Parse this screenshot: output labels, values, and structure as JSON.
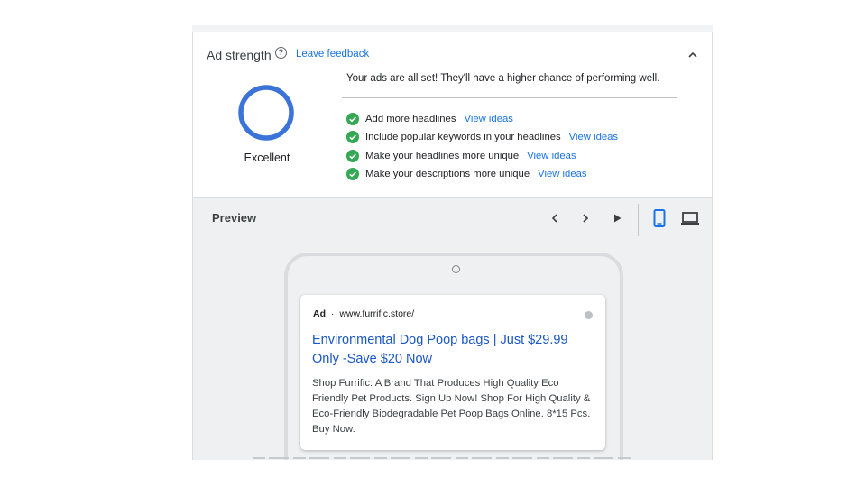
{
  "ad_strength": {
    "title": "Ad strength",
    "help_icon": "help-circle-icon",
    "feedback_link": "Leave feedback",
    "collapse_icon": "chevron-up-icon",
    "rating": "Excellent",
    "rating_color": "#3b73d9",
    "status_message": "Your ads are all set! They'll have a higher chance of performing well.",
    "check_color": "#34a853",
    "suggestions": [
      {
        "text": "Add more headlines",
        "link": "View ideas"
      },
      {
        "text": "Include popular keywords in your headlines",
        "link": "View ideas"
      },
      {
        "text": "Make your headlines more unique",
        "link": "View ideas"
      },
      {
        "text": "Make your descriptions more unique",
        "link": "View ideas"
      }
    ]
  },
  "preview": {
    "title": "Preview",
    "controls": [
      "chevron-left-icon",
      "chevron-right-icon",
      "play-icon",
      "mobile-device-icon",
      "laptop-icon"
    ],
    "ad": {
      "badge": "Ad",
      "separator": "·",
      "url": "www.furrific.store/",
      "headline": "Environmental Dog Poop bags | Just $29.99 Only -Save $20 Now",
      "description": "Shop Furrific: A Brand That Produces High Quality Eco Friendly Pet Products. Sign Up Now! Shop For High Quality & Eco-Friendly Biodegradable Pet Poop Bags Online. 8*15 Pcs. Buy Now."
    },
    "accent_color": "#1a73e8"
  }
}
